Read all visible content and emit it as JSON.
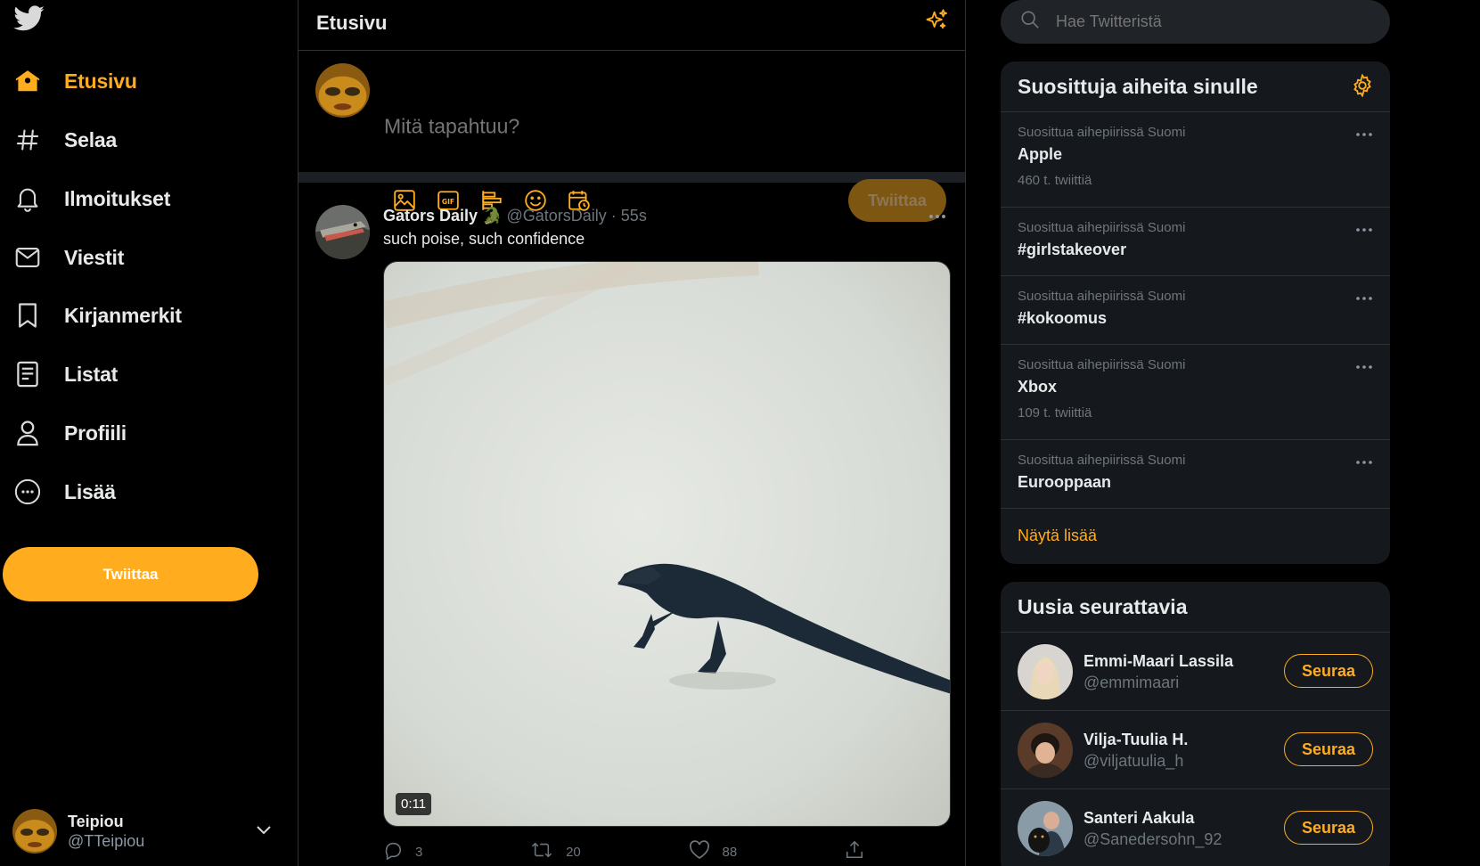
{
  "brand": {
    "accent": "#ffad1f",
    "logo_icon": "twitter-bird-icon"
  },
  "nav": {
    "items": [
      {
        "label": "Etusivu",
        "icon": "home-icon",
        "active": true
      },
      {
        "label": "Selaa",
        "icon": "hashtag-icon"
      },
      {
        "label": "Ilmoitukset",
        "icon": "bell-icon"
      },
      {
        "label": "Viestit",
        "icon": "mail-icon"
      },
      {
        "label": "Kirjanmerkit",
        "icon": "bookmark-icon"
      },
      {
        "label": "Listat",
        "icon": "list-icon"
      },
      {
        "label": "Profiili",
        "icon": "user-icon"
      },
      {
        "label": "Lisää",
        "icon": "more-circle-icon"
      }
    ],
    "tweet_button": "Twiittaa"
  },
  "account": {
    "display_name": "Teipiou",
    "handle": "@TTeipiou"
  },
  "main": {
    "title": "Etusivu",
    "composer": {
      "placeholder": "Mitä tapahtuu?",
      "tweet_button": "Twiittaa"
    },
    "tweet": {
      "display_name": "Gators Daily 🐊",
      "handle": "@GatorsDaily",
      "time": "55s",
      "text": "such poise, such confidence",
      "media_duration": "0:11",
      "replies": "3",
      "retweets": "20",
      "likes": "88"
    }
  },
  "right": {
    "search_placeholder": "Hae Twitteristä",
    "trends": {
      "title": "Suosittuja aiheita sinulle",
      "items": [
        {
          "context": "Suosittua aihepiirissä Suomi",
          "name": "Apple",
          "count": "460 t. twiittiä"
        },
        {
          "context": "Suosittua aihepiirissä Suomi",
          "name": "#girlstakeover",
          "count": ""
        },
        {
          "context": "Suosittua aihepiirissä Suomi",
          "name": "#kokoomus",
          "count": ""
        },
        {
          "context": "Suosittua aihepiirissä Suomi",
          "name": "Xbox",
          "count": "109 t. twiittiä"
        },
        {
          "context": "Suosittua aihepiirissä Suomi",
          "name": "Eurooppaan",
          "count": ""
        }
      ],
      "show_more": "Näytä lisää"
    },
    "who_to_follow": {
      "title": "Uusia seurattavia",
      "items": [
        {
          "name": "Emmi-Maari Lassila",
          "handle": "@emmimaari",
          "button": "Seuraa"
        },
        {
          "name": "Vilja-Tuulia H.",
          "handle": "@viljatuulia_h",
          "button": "Seuraa"
        },
        {
          "name": "Santeri Aakula",
          "handle": "@Sanedersohn_92",
          "button": "Seuraa"
        }
      ]
    }
  }
}
